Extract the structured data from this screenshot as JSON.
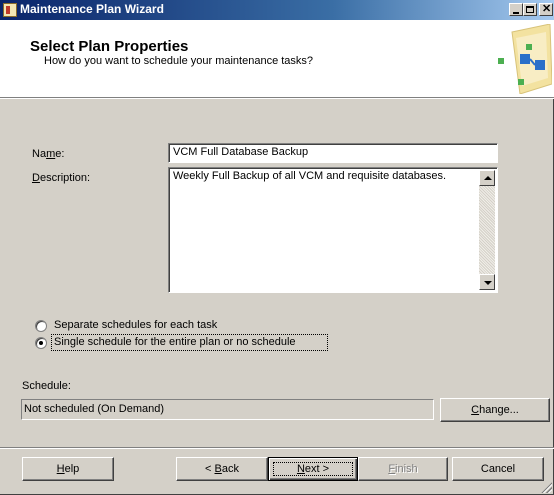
{
  "window": {
    "title": "Maintenance Plan Wizard"
  },
  "header": {
    "title": "Select Plan Properties",
    "subtitle": "How do you want to schedule your maintenance tasks?"
  },
  "form": {
    "name_label_pre": "Na",
    "name_label_accel": "m",
    "name_label_post": "e:",
    "name_value": "VCM Full Database Backup",
    "description_label_accel": "D",
    "description_label_post": "escription:",
    "description_value": "Weekly Full Backup of all VCM and requisite databases."
  },
  "schedule_options": {
    "separate_label": "Separate schedules for each task",
    "single_label": "Single schedule for the entire plan or no schedule",
    "selected": "single"
  },
  "schedule": {
    "label": "Schedule:",
    "value": "Not scheduled (On Demand)",
    "change_button_accel": "C",
    "change_button_post": "hange..."
  },
  "buttons": {
    "help_accel": "H",
    "help_post": "elp",
    "back_pre": "< ",
    "back_accel": "B",
    "back_post": "ack",
    "next_accel": "N",
    "next_post": "ext >",
    "finish_accel": "F",
    "finish_post": "inish",
    "cancel": "Cancel"
  },
  "colors": {
    "titlebar": "#0a246a",
    "face": "#d4d0c8"
  }
}
